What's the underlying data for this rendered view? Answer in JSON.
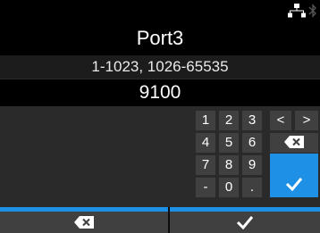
{
  "screen": {
    "title": "Port3",
    "range_hint": "1-1023, 1026-65535",
    "value": "9100"
  },
  "status_bar": {
    "icons": [
      "network-icon",
      "bluetooth-icon"
    ]
  },
  "keypad": {
    "row1": [
      "1",
      "2",
      "3",
      "<",
      ">"
    ],
    "row2": [
      "4",
      "5",
      "6"
    ],
    "row3": [
      "7",
      "8",
      "9"
    ],
    "row4": [
      "-",
      "0",
      "."
    ],
    "icons": [
      "backspace-icon",
      "checkmark-icon"
    ]
  },
  "bottom_bar": {
    "icons": [
      "backspace-icon",
      "checkmark-icon"
    ]
  },
  "colors": {
    "accent": "#1e90e6",
    "key_bg": "#404040",
    "panel_bg": "#2a2a2a"
  }
}
